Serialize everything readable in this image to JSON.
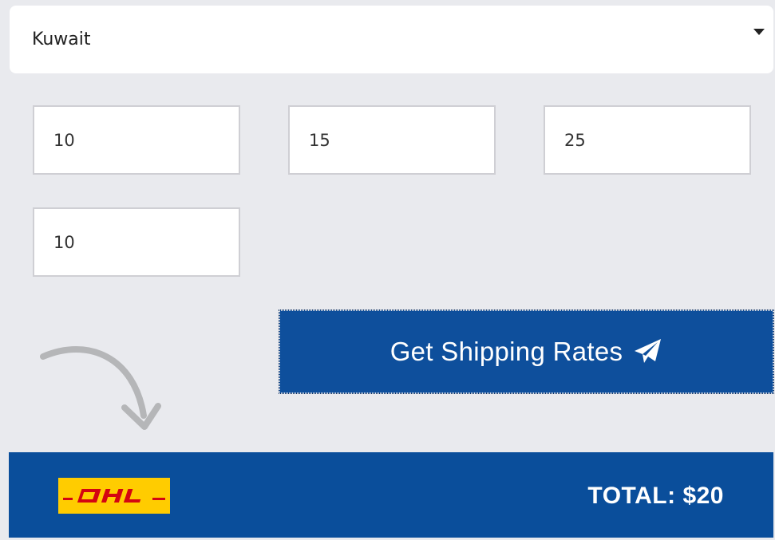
{
  "country_select": {
    "selected": "Kuwait"
  },
  "dimensions": {
    "length": "10",
    "width": "15",
    "height": "25",
    "weight": "10"
  },
  "rates_button": {
    "label": "Get Shipping Rates",
    "icon": "paper-plane-icon"
  },
  "result": {
    "carrier_logo": "DHL",
    "total_label": "TOTAL: $20"
  },
  "colors": {
    "background": "#e9eaee",
    "button_blue": "#0e4f9c",
    "result_blue": "#0a4e9b",
    "dhl_yellow": "#ffcc00",
    "dhl_red": "#d40511"
  }
}
